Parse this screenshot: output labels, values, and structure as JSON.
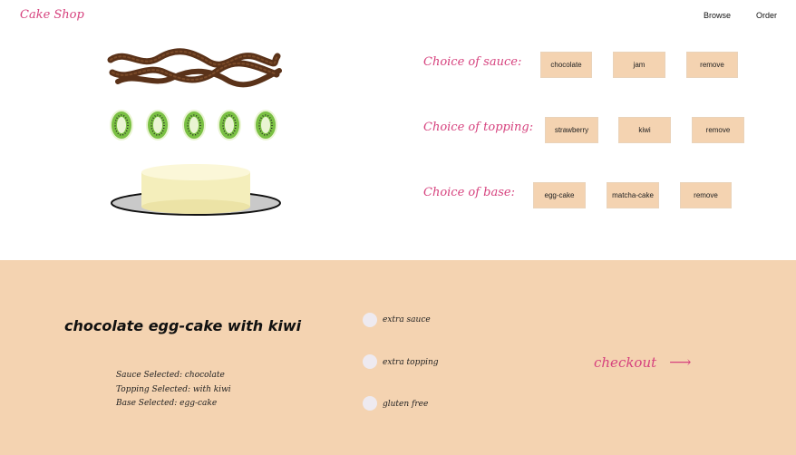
{
  "header": {
    "logo": "Cake Shop",
    "nav": [
      "Browse",
      "Order"
    ]
  },
  "choices": {
    "sauce": {
      "label": "Choice of sauce:",
      "options": [
        "chocolate",
        "jam",
        "remove"
      ]
    },
    "topping": {
      "label": "Choice of topping:",
      "options": [
        "strawberry",
        "kiwi",
        "remove"
      ]
    },
    "base": {
      "label": "Choice of base:",
      "options": [
        "egg-cake",
        "matcha-cake",
        "remove"
      ]
    }
  },
  "summary": {
    "title": "chocolate egg-cake with kiwi",
    "sauce_line": "Sauce Selected: chocolate",
    "topping_line": "Topping Selected: with kiwi",
    "base_line": "Base Selected: egg-cake"
  },
  "extras": [
    "extra sauce",
    "extra topping",
    "gluten free"
  ],
  "checkout": {
    "label": "checkout",
    "arrow": "⟶"
  },
  "colors": {
    "accent": "#d6427e",
    "panel": "#f4d3b1",
    "button": "#f4d3b1",
    "chocolate": "#5a3219",
    "kiwi": "#7ac043",
    "cake": "#f4eebb"
  },
  "icons": [
    "chocolate-drizzle-icon",
    "kiwi-slice-icon",
    "cake-base-icon",
    "radio-icon",
    "arrow-right-icon"
  ]
}
